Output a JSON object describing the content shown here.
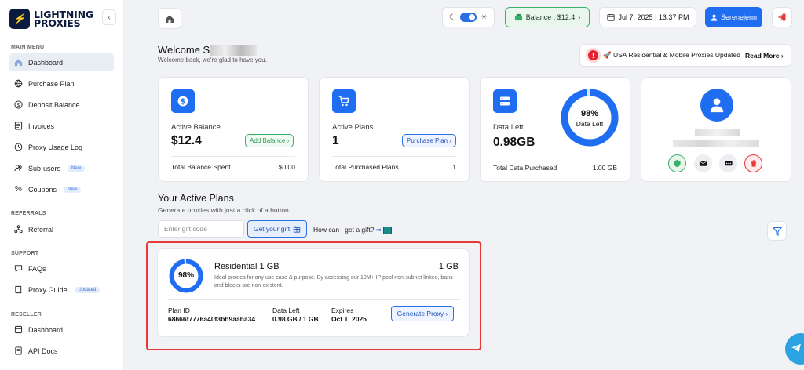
{
  "brand": {
    "line1": "LIGHTNING",
    "line2": "PROXIES"
  },
  "sidebar": {
    "collapse_icon": "chevron-left-icon",
    "main_menu_label": "MAIN MENU",
    "main_menu": [
      {
        "label": "Dashboard",
        "icon": "home-icon",
        "active": true
      },
      {
        "label": "Purchase Plan",
        "icon": "globe-icon"
      },
      {
        "label": "Deposit Balance",
        "icon": "dollar-icon"
      },
      {
        "label": "Invoices",
        "icon": "invoice-icon"
      },
      {
        "label": "Proxy Usage Log",
        "icon": "clock-icon"
      },
      {
        "label": "Sub-users",
        "icon": "users-icon",
        "badge": "New"
      },
      {
        "label": "Coupons",
        "icon": "percent-icon",
        "badge": "New"
      }
    ],
    "referrals_label": "REFERRALS",
    "referrals": [
      {
        "label": "Referral",
        "icon": "network-icon"
      }
    ],
    "support_label": "SUPPORT",
    "support": [
      {
        "label": "FAQs",
        "icon": "chat-icon"
      },
      {
        "label": "Proxy Guide",
        "icon": "book-icon",
        "badge": "Updated"
      }
    ],
    "reseller_label": "RESELLER",
    "reseller": [
      {
        "label": "Dashboard",
        "icon": "layers-icon"
      },
      {
        "label": "API Docs",
        "icon": "doc-icon"
      }
    ]
  },
  "topbar": {
    "balance": "Balance : $12.4",
    "datetime": "Jul 7, 2025 | 13:37 PM",
    "username": "Serenejenn"
  },
  "welcome": {
    "title_prefix": "Welcome S",
    "subtitle": "Welcome back, we're glad to have you.",
    "news_text": "🚀 USA Residential & Mobile Proxies Updated",
    "news_link": "Read More"
  },
  "cards": {
    "balance": {
      "label": "Active Balance",
      "value": "$12.4",
      "action": "Add Balance",
      "footer_label": "Total Balance Spent",
      "footer_value": "$0.00"
    },
    "plans": {
      "label": "Active Plans",
      "value": "1",
      "action": "Purchase Plan",
      "footer_label": "Total Purchased Plans",
      "footer_value": "1"
    },
    "data": {
      "label": "Data Left",
      "value": "0.98GB",
      "ring_value": "98%",
      "ring_label": "Data Left",
      "ring_fraction": 0.98,
      "footer_label": "Total Data Purchased",
      "footer_value": "1.00 GB"
    }
  },
  "active_plans": {
    "title": "Your Active Plans",
    "subtitle": "Generate proxies with just a click of a button",
    "gift_placeholder": "Enter gift code",
    "gift_button": "Get your gift",
    "gift_help": "How can I get a gift?",
    "plan": {
      "name": "Residential 1 GB",
      "size": "1 GB",
      "ring_value": "98%",
      "ring_fraction": 0.98,
      "description": "Ideal proxies for any use case & purpose. By accessing our 10M+ IP pool non-subnet linked, bans and blocks are non-existent.",
      "id_label": "Plan ID",
      "id_value": "68666f7776a40f3bb9aaba34",
      "data_label": "Data Left",
      "data_value": "0.98 GB / 1 GB",
      "expires_label": "Expires",
      "expires_value": "Oct 1, 2025",
      "button": "Generate Proxy"
    }
  },
  "colors": {
    "primary": "#1f6df0",
    "success": "#39b069",
    "danger": "#e53935",
    "ring_track": "#dce6f8"
  }
}
